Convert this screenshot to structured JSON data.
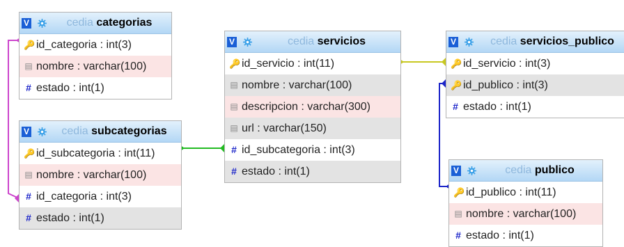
{
  "tables": [
    {
      "id": "categorias",
      "db": "cedia",
      "name": "categorias",
      "fields": [
        {
          "icon": "key-icon",
          "text": "id_categoria : int(3)",
          "bg": "w"
        },
        {
          "icon": "text-icon",
          "text": "nombre : varchar(100)",
          "bg": "p"
        },
        {
          "icon": "hash-icon",
          "text": "estado : int(1)",
          "bg": "w"
        }
      ]
    },
    {
      "id": "subcategorias",
      "db": "cedia",
      "name": "subcategorias",
      "fields": [
        {
          "icon": "key-icon",
          "text": "id_subcategoria : int(11)",
          "bg": "w"
        },
        {
          "icon": "text-icon",
          "text": "nombre : varchar(100)",
          "bg": "p"
        },
        {
          "icon": "hash-icon",
          "text": "id_categoria : int(3)",
          "bg": "w"
        },
        {
          "icon": "hash-icon",
          "text": "estado : int(1)",
          "bg": "g"
        }
      ]
    },
    {
      "id": "servicios",
      "db": "cedia",
      "name": "servicios",
      "fields": [
        {
          "icon": "key-icon",
          "text": "id_servicio : int(11)",
          "bg": "w"
        },
        {
          "icon": "text-icon",
          "text": "nombre : varchar(100)",
          "bg": "g"
        },
        {
          "icon": "text-icon",
          "text": "descripcion : varchar(300)",
          "bg": "p"
        },
        {
          "icon": "text-icon",
          "text": "url : varchar(150)",
          "bg": "g"
        },
        {
          "icon": "hash-icon",
          "text": "id_subcategoria : int(3)",
          "bg": "w"
        },
        {
          "icon": "hash-icon",
          "text": "estado : int(1)",
          "bg": "g"
        }
      ]
    },
    {
      "id": "servicios_publico",
      "db": "cedia",
      "name": "servicios_publico",
      "fields": [
        {
          "icon": "key-icon",
          "text": "id_servicio : int(3)",
          "bg": "w"
        },
        {
          "icon": "key-icon",
          "text": "id_publico : int(3)",
          "bg": "g"
        },
        {
          "icon": "hash-icon",
          "text": "estado : int(1)",
          "bg": "w"
        }
      ]
    },
    {
      "id": "publico",
      "db": "cedia",
      "name": "publico",
      "fields": [
        {
          "icon": "key-icon",
          "text": "id_publico : int(11)",
          "bg": "w"
        },
        {
          "icon": "text-icon",
          "text": "nombre : varchar(100)",
          "bg": "p"
        },
        {
          "icon": "hash-icon",
          "text": "estado : int(1)",
          "bg": "w"
        }
      ]
    }
  ],
  "header_button_label": "V",
  "relations": [
    {
      "from": "subcategorias.id_categoria",
      "to": "categorias.id_categoria",
      "color": "#cc44cc"
    },
    {
      "from": "servicios.id_subcategoria",
      "to": "subcategorias.id_subcategoria",
      "color": "#22bb22"
    },
    {
      "from": "servicios_publico.id_servicio",
      "to": "servicios.id_servicio",
      "color": "#c8c820"
    },
    {
      "from": "servicios_publico.id_publico",
      "to": "publico.id_publico",
      "color": "#1c25c9"
    }
  ],
  "colors": {
    "header": "#b3d7f5",
    "db_name": "#8fb8dd",
    "key": "#b38a1c",
    "hash": "#1c25c9",
    "pink_row": "#fbe4e4",
    "gray_row": "#e3e3e3"
  }
}
